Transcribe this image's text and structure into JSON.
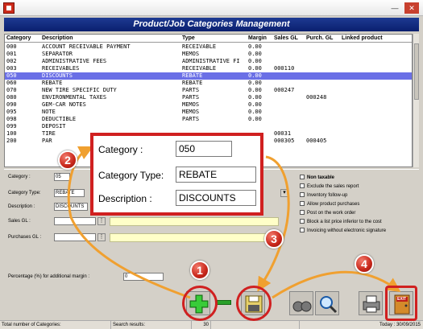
{
  "window": {
    "title": "",
    "min_glyph": "—",
    "close_glyph": "✕"
  },
  "header": {
    "title": "Product/Job Categories Management"
  },
  "grid": {
    "columns": [
      "Category",
      "Description",
      "Type",
      "Margin",
      "Sales GL",
      "Purch. GL",
      "Linked product"
    ],
    "rows": [
      [
        "000",
        "ACCOUNT RECEIVABLE PAYMENT",
        "RECEIVABLE",
        "0.00",
        "",
        "",
        ""
      ],
      [
        "001",
        "SEPARATOR",
        "MEMOS",
        "0.00",
        "",
        "",
        ""
      ],
      [
        "002",
        "ADMINISTRATIVE FEES",
        "ADMINISTRATIVE FI",
        "0.00",
        "",
        "",
        ""
      ],
      [
        "003",
        "RECEIVABLES",
        "RECEIVABLE",
        "0.00",
        "000110",
        "",
        ""
      ],
      [
        "050",
        "DISCOUNTS",
        "REBATE",
        "0.00",
        "",
        "",
        ""
      ],
      [
        "060",
        "REBATE",
        "REBATE",
        "0.00",
        "",
        "",
        ""
      ],
      [
        "070",
        "NEW TIRE SPECIFIC DUTY",
        "PARTS",
        "0.00",
        "000247",
        "",
        ""
      ],
      [
        "080",
        "ENVIRONMENTAL TAXES",
        "PARTS",
        "0.00",
        "",
        "000248",
        ""
      ],
      [
        "090",
        "GEM-CAR NOTES",
        "MEMOS",
        "0.00",
        "",
        "",
        ""
      ],
      [
        "095",
        "NOTE",
        "MEMOS",
        "0.00",
        "",
        "",
        ""
      ],
      [
        "098",
        "DEDUCTIBLE",
        "PARTS",
        "0.00",
        "",
        "",
        ""
      ],
      [
        "099",
        "DEPOSIT",
        "",
        "",
        "",
        "",
        ""
      ],
      [
        "100",
        "TIRE",
        "",
        "",
        "00031",
        "",
        ""
      ],
      [
        "200",
        "PAR",
        "",
        "",
        "000305",
        "000405",
        ""
      ]
    ],
    "selected_row": 4
  },
  "form": {
    "category_label": "Category :",
    "category_value": "05",
    "type_label": "Category Type:",
    "type_value": "REBATE",
    "description_label": "Description :",
    "description_value": "DISCOUNTS",
    "sales_gl_label": "Sales GL :",
    "purchases_gl_label": "Purchases GL :",
    "margin_label": "Percentage (%) for additional margin :",
    "margin_value": "0"
  },
  "options": {
    "non_taxable": "Non taxable",
    "exclude_sales": "Exclude the sales report",
    "inventory_followup": "Inventory follow-up",
    "allow_purchases": "Allow product purchases",
    "post_work_order": "Post on the work order",
    "block_price": "Block a list price inferior to the cost",
    "invoicing_no_signature": "Invoicing without electronic signature"
  },
  "callout": {
    "category_label": "Category :",
    "category_value": "050",
    "type_label": "Category Type:",
    "type_value": "REBATE",
    "description_label": "Description :",
    "description_value": "DISCOUNTS"
  },
  "badges": {
    "b1": "1",
    "b2": "2",
    "b3": "3",
    "b4": "4"
  },
  "toolbar": {
    "exit_label": "EXIT"
  },
  "status": {
    "total_label": "Total number of Categories:",
    "search_label": "Search results:",
    "search_value": "30",
    "today": "Today : 30/09/2015"
  },
  "icons": [
    "app-icon",
    "add-icon",
    "save-icon",
    "search-icon",
    "print-icon",
    "exit-icon",
    "lookup-icon"
  ],
  "colors": {
    "banner": "#0a1f6e",
    "selected_row": "#6a6fe6",
    "callout_border": "#d02020",
    "arrow": "#f0a030"
  }
}
